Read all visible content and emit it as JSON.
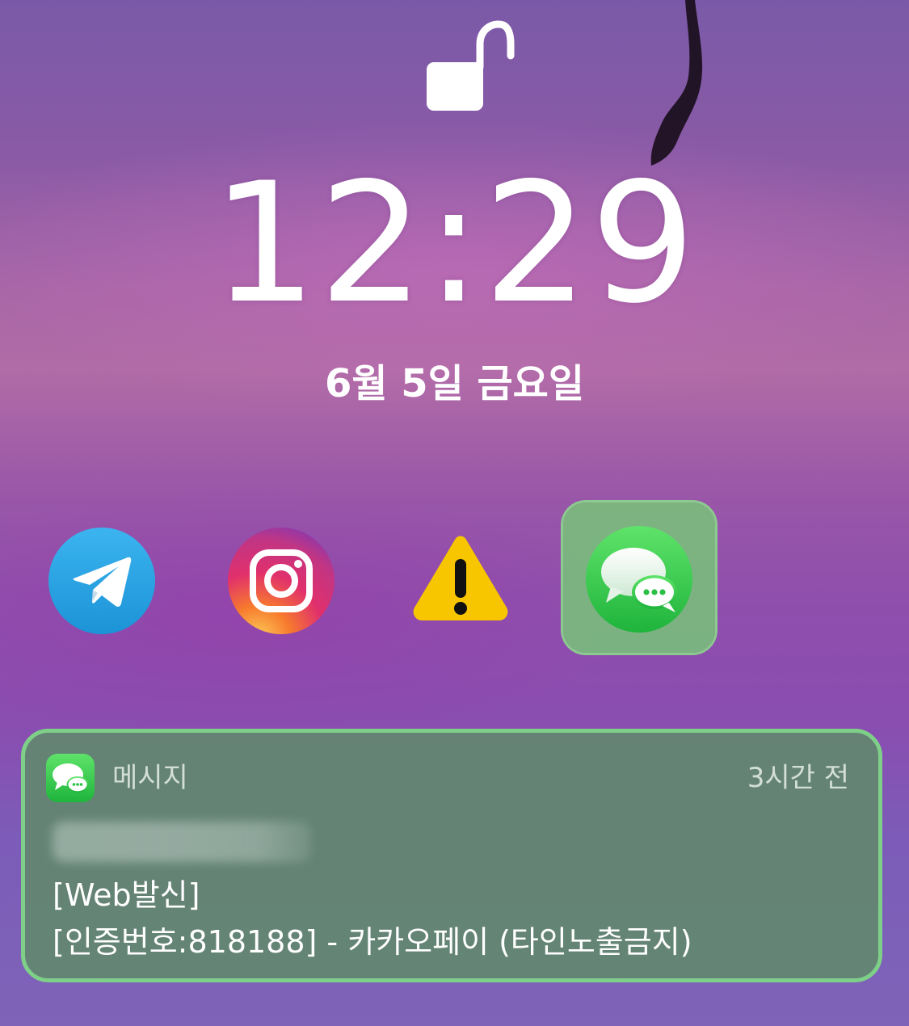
{
  "lock_screen": {
    "lock_state": "unlocked",
    "time": "12:29",
    "date": "6월 5일 금요일"
  },
  "app_row": {
    "icons": [
      "telegram-icon",
      "instagram-icon",
      "warning-icon",
      "messages-icon"
    ],
    "selected": "messages-icon"
  },
  "notification": {
    "app_name": "메시지",
    "time_ago": "3시간 전",
    "sender": "+82 1599-4134",
    "sender_blurred": true,
    "body_line1": "[Web발신]",
    "body_line2": "[인증번호:818188] - 카카오페이 (타인노출금지)"
  },
  "colors": {
    "accent_green": "#7ed088",
    "notification_bg": "#628770",
    "messages_green": "#34c759",
    "telegram_blue": "#2aa3e0",
    "warning_yellow": "#f7c600"
  }
}
